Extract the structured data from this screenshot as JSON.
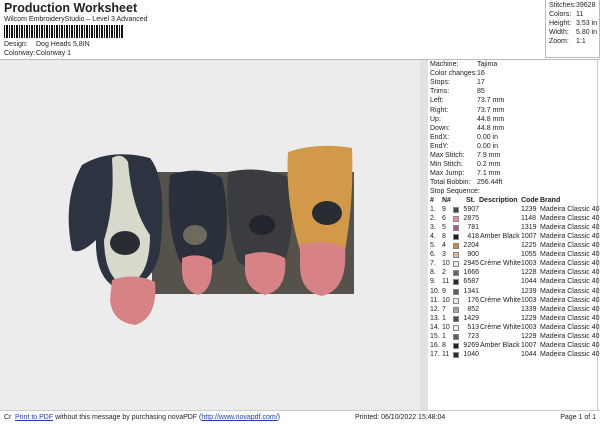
{
  "header": {
    "title": "Production Worksheet",
    "subtitle": "Wilcom EmbroideryStudio – Level 3 Advanced",
    "design_label": "Design:",
    "design_value": "Dog Heads 5,8IN",
    "colorway_label": "Colorway:",
    "colorway_value": "Colorway 1"
  },
  "stats": [
    {
      "label": "Stitches:",
      "value": "39628"
    },
    {
      "label": "Colors:",
      "value": "11"
    },
    {
      "label": "Height:",
      "value": "3.53 in"
    },
    {
      "label": "Width:",
      "value": "5.80 in"
    },
    {
      "label": "Zoom:",
      "value": "1:1"
    }
  ],
  "machine": [
    {
      "label": "Machine:",
      "value": "Tajima"
    },
    {
      "label": "Color changes:",
      "value": "16"
    },
    {
      "label": "Stops:",
      "value": "17"
    },
    {
      "label": "Trims:",
      "value": "85"
    },
    {
      "label": "Left:",
      "value": "73.7 mm"
    },
    {
      "label": "Right:",
      "value": "73.7 mm"
    },
    {
      "label": "Up:",
      "value": "44.8 mm"
    },
    {
      "label": "Down:",
      "value": "44.8 mm"
    },
    {
      "label": "EndX:",
      "value": "0.00 in"
    },
    {
      "label": "EndY:",
      "value": "0.00 in"
    },
    {
      "label": "Max Stitch:",
      "value": "7.9 mm"
    },
    {
      "label": "Min Stitch:",
      "value": "0.2 mm"
    },
    {
      "label": "Max Jump:",
      "value": "7.1 mm"
    },
    {
      "label": "Total Bobbin:",
      "value": "256.44ft"
    }
  ],
  "stop_sequence": {
    "title": "Stop Sequence:",
    "headers": [
      "#",
      "N#",
      "St.",
      "Description",
      "Code",
      "Brand"
    ],
    "rows": [
      [
        "1.",
        "9",
        "5907",
        "",
        "1239",
        "Madeira Classic 40",
        "#4a4848"
      ],
      [
        "2.",
        "6",
        "2875",
        "",
        "1148",
        "Madeira Classic 40",
        "#e08e9c"
      ],
      [
        "3.",
        "5",
        "781",
        "",
        "1319",
        "Madeira Classic 40",
        "#a85a8c"
      ],
      [
        "4.",
        "8",
        "418",
        "Amber Black",
        "1007",
        "Madeira Classic 40",
        "#1e1e1e"
      ],
      [
        "5.",
        "4",
        "2204",
        "",
        "1225",
        "Madeira Classic 40",
        "#d08a3a"
      ],
      [
        "6.",
        "3",
        "900",
        "",
        "1055",
        "Madeira Classic 40",
        "#e2b890"
      ],
      [
        "7.",
        "10",
        "2945",
        "Crème White",
        "1003",
        "Madeira Classic 40",
        "#ececec"
      ],
      [
        "8.",
        "2",
        "1666",
        "",
        "1228",
        "Madeira Classic 40",
        "#6e6055"
      ],
      [
        "9.",
        "11",
        "6587",
        "",
        "1044",
        "Madeira Classic 40",
        "#252a36"
      ],
      [
        "10.",
        "9",
        "1341",
        "",
        "1239",
        "Madeira Classic 40",
        "#5e5e5e"
      ],
      [
        "11.",
        "10",
        "176",
        "Crème White",
        "1003",
        "Madeira Classic 40",
        "#ececec"
      ],
      [
        "12.",
        "7",
        "852",
        "",
        "1339",
        "Madeira Classic 40",
        "#a8a898"
      ],
      [
        "13.",
        "1",
        "1429",
        "",
        "1229",
        "Madeira Classic 40",
        "#5a4a40"
      ],
      [
        "14.",
        "10",
        "513",
        "Crème White",
        "1003",
        "Madeira Classic 40",
        "#ececec"
      ],
      [
        "15.",
        "1",
        "723",
        "",
        "1229",
        "Madeira Classic 40",
        "#6a5a4a"
      ],
      [
        "16.",
        "8",
        "9269",
        "Amber Black",
        "1007",
        "Madeira Classic 40",
        "#1e1e1e"
      ],
      [
        "17.",
        "11",
        "1040",
        "",
        "1044",
        "Madeira Classic 40",
        "#252a36"
      ]
    ]
  },
  "footer": {
    "prefix": "Cr",
    "link": "Print to PDF",
    "message": " without this message by purchasing novaPDF (",
    "url": "http://www.novapdf.com/",
    "close": ")",
    "printed": "Printed: 06/10/2022 15:48:04",
    "page": "Page 1 of 1"
  }
}
